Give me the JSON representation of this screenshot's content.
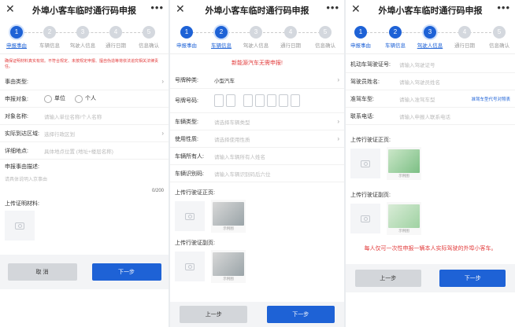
{
  "app_title": "外埠小客车临时通行码申报",
  "icons": {
    "close": "close-icon",
    "more": "more-icon",
    "camera": "camera-icon",
    "chevron": "chevron-right-icon"
  },
  "colors": {
    "primary": "#1e62d6",
    "warning": "#e23b3b"
  },
  "steps": [
    {
      "num": "1",
      "label": "申报事由"
    },
    {
      "num": "2",
      "label": "车辆信息"
    },
    {
      "num": "3",
      "label": "驾驶人信息"
    },
    {
      "num": "4",
      "label": "通行日期"
    },
    {
      "num": "5",
      "label": "信息确认"
    }
  ],
  "panel1": {
    "notice": "确保证明材料真实有效。不符合规定、未按规定申报、擅自伪造等将依法追究相关法律责任。",
    "fields": [
      {
        "label": "事由类型:",
        "value": ""
      },
      {
        "label": "申报对象:",
        "value": ""
      },
      {
        "label": "对象名称:",
        "value": "请输入单位名称/个人名称"
      },
      {
        "label": "实际到达区域:",
        "value": "选择行政区划"
      },
      {
        "label": "详细地点:",
        "value": "具体地点位置 (地址+楼层名称)"
      }
    ],
    "radio_unit": "单位",
    "radio_person": "个人",
    "desc_label": "申报事由描述:",
    "desc_placeholder": "请具体说明入京事由",
    "desc_count": "0/200",
    "upload_label": "上传证明材料:",
    "cancel": "取 消",
    "next": "下一步"
  },
  "panel2": {
    "notice": "新能源汽车无需申报!",
    "plate_type_label": "号牌种类:",
    "plate_type_value": "小型汽车",
    "plate_no_label": "号牌号码:",
    "fields": [
      {
        "label": "车辆类型:",
        "value": "请选择车辆类型"
      },
      {
        "label": "使用性质:",
        "value": "请选择使用性质"
      },
      {
        "label": "车辆所有人:",
        "value": "请输入车辆所有人姓名"
      },
      {
        "label": "车辆识别码:",
        "value": "请输入车辆识别码后六位"
      }
    ],
    "upload_front": "上传行驶证正页:",
    "upload_back": "上传行驶证副页:",
    "sample_caption": "示例图",
    "prev": "上一步",
    "next": "下一步"
  },
  "panel3": {
    "fields": [
      {
        "label": "机动车驾驶证号:",
        "value": "请输入驾驶证号"
      },
      {
        "label": "驾驶员姓名:",
        "value": "请输入驾驶员姓名"
      },
      {
        "label": "准驾车型:",
        "value": "请输入准驾车型"
      },
      {
        "label": "联系电话:",
        "value": "请输入申报人联系电话"
      }
    ],
    "helper_link": "准驾车型代号对照表",
    "upload_front": "上传行驶证正页:",
    "upload_back": "上传行驶证副页:",
    "sample_caption": "示例图",
    "notice": "每人仅可一次性申报一辆本人实际驾驶的外埠小客车。",
    "prev": "上一步",
    "next": "下一步"
  }
}
